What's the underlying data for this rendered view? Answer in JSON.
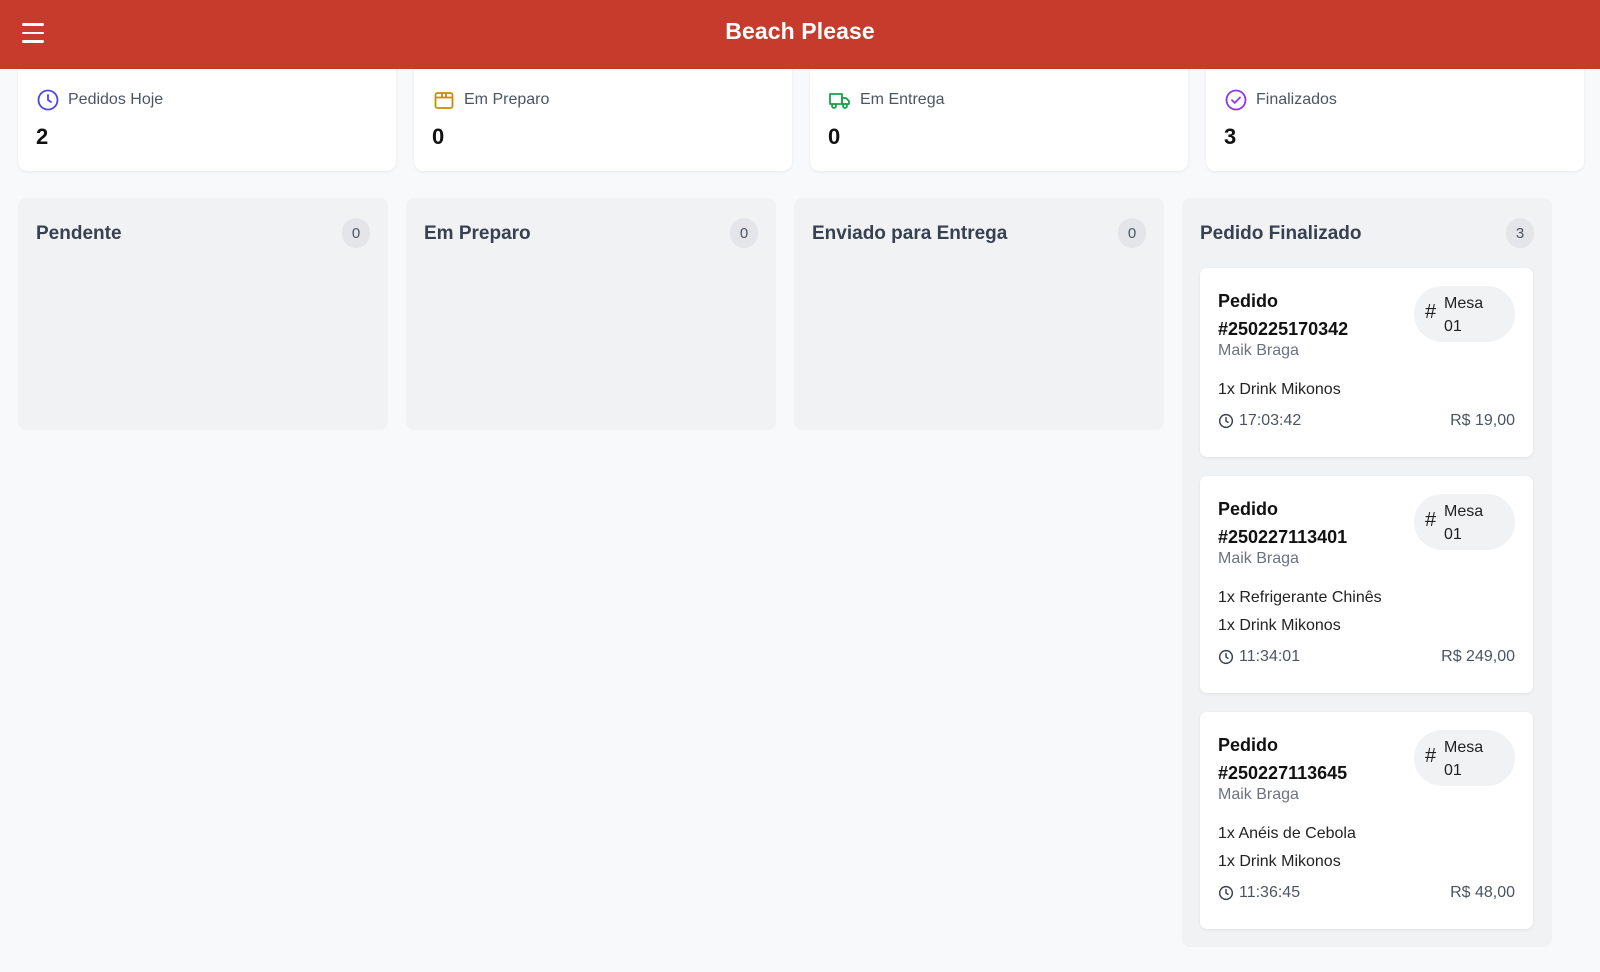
{
  "header": {
    "title": "Beach Please"
  },
  "stats": [
    {
      "label": "Pedidos Hoje",
      "value": "2",
      "icon": "clock-icon",
      "color": "#4f46e5"
    },
    {
      "label": "Em Preparo",
      "value": "0",
      "icon": "package-icon",
      "color": "#ca8a04"
    },
    {
      "label": "Em Entrega",
      "value": "0",
      "icon": "truck-icon",
      "color": "#16a34a"
    },
    {
      "label": "Finalizados",
      "value": "3",
      "icon": "check-circle-icon",
      "color": "#9333ea"
    }
  ],
  "columns": [
    {
      "title": "Pendente",
      "count": "0"
    },
    {
      "title": "Em Preparo",
      "count": "0"
    },
    {
      "title": "Enviado para Entrega",
      "count": "0"
    },
    {
      "title": "Pedido Finalizado",
      "count": "3"
    }
  ],
  "orders": [
    {
      "title": "Pedido #250225170342",
      "customer": "Maik Braga",
      "mesa": "Mesa 01",
      "items": [
        "1x Drink Mikonos"
      ],
      "time": "17:03:42",
      "price": "R$ 19,00"
    },
    {
      "title": "Pedido #250227113401",
      "customer": "Maik Braga",
      "mesa": "Mesa 01",
      "items": [
        "1x Refrigerante Chinês",
        "1x Drink Mikonos"
      ],
      "time": "11:34:01",
      "price": "R$ 249,00"
    },
    {
      "title": "Pedido #250227113645",
      "customer": "Maik Braga",
      "mesa": "Mesa 01",
      "items": [
        "1x Anéis de Cebola",
        "1x Drink Mikonos"
      ],
      "time": "11:36:45",
      "price": "R$ 48,00"
    }
  ]
}
